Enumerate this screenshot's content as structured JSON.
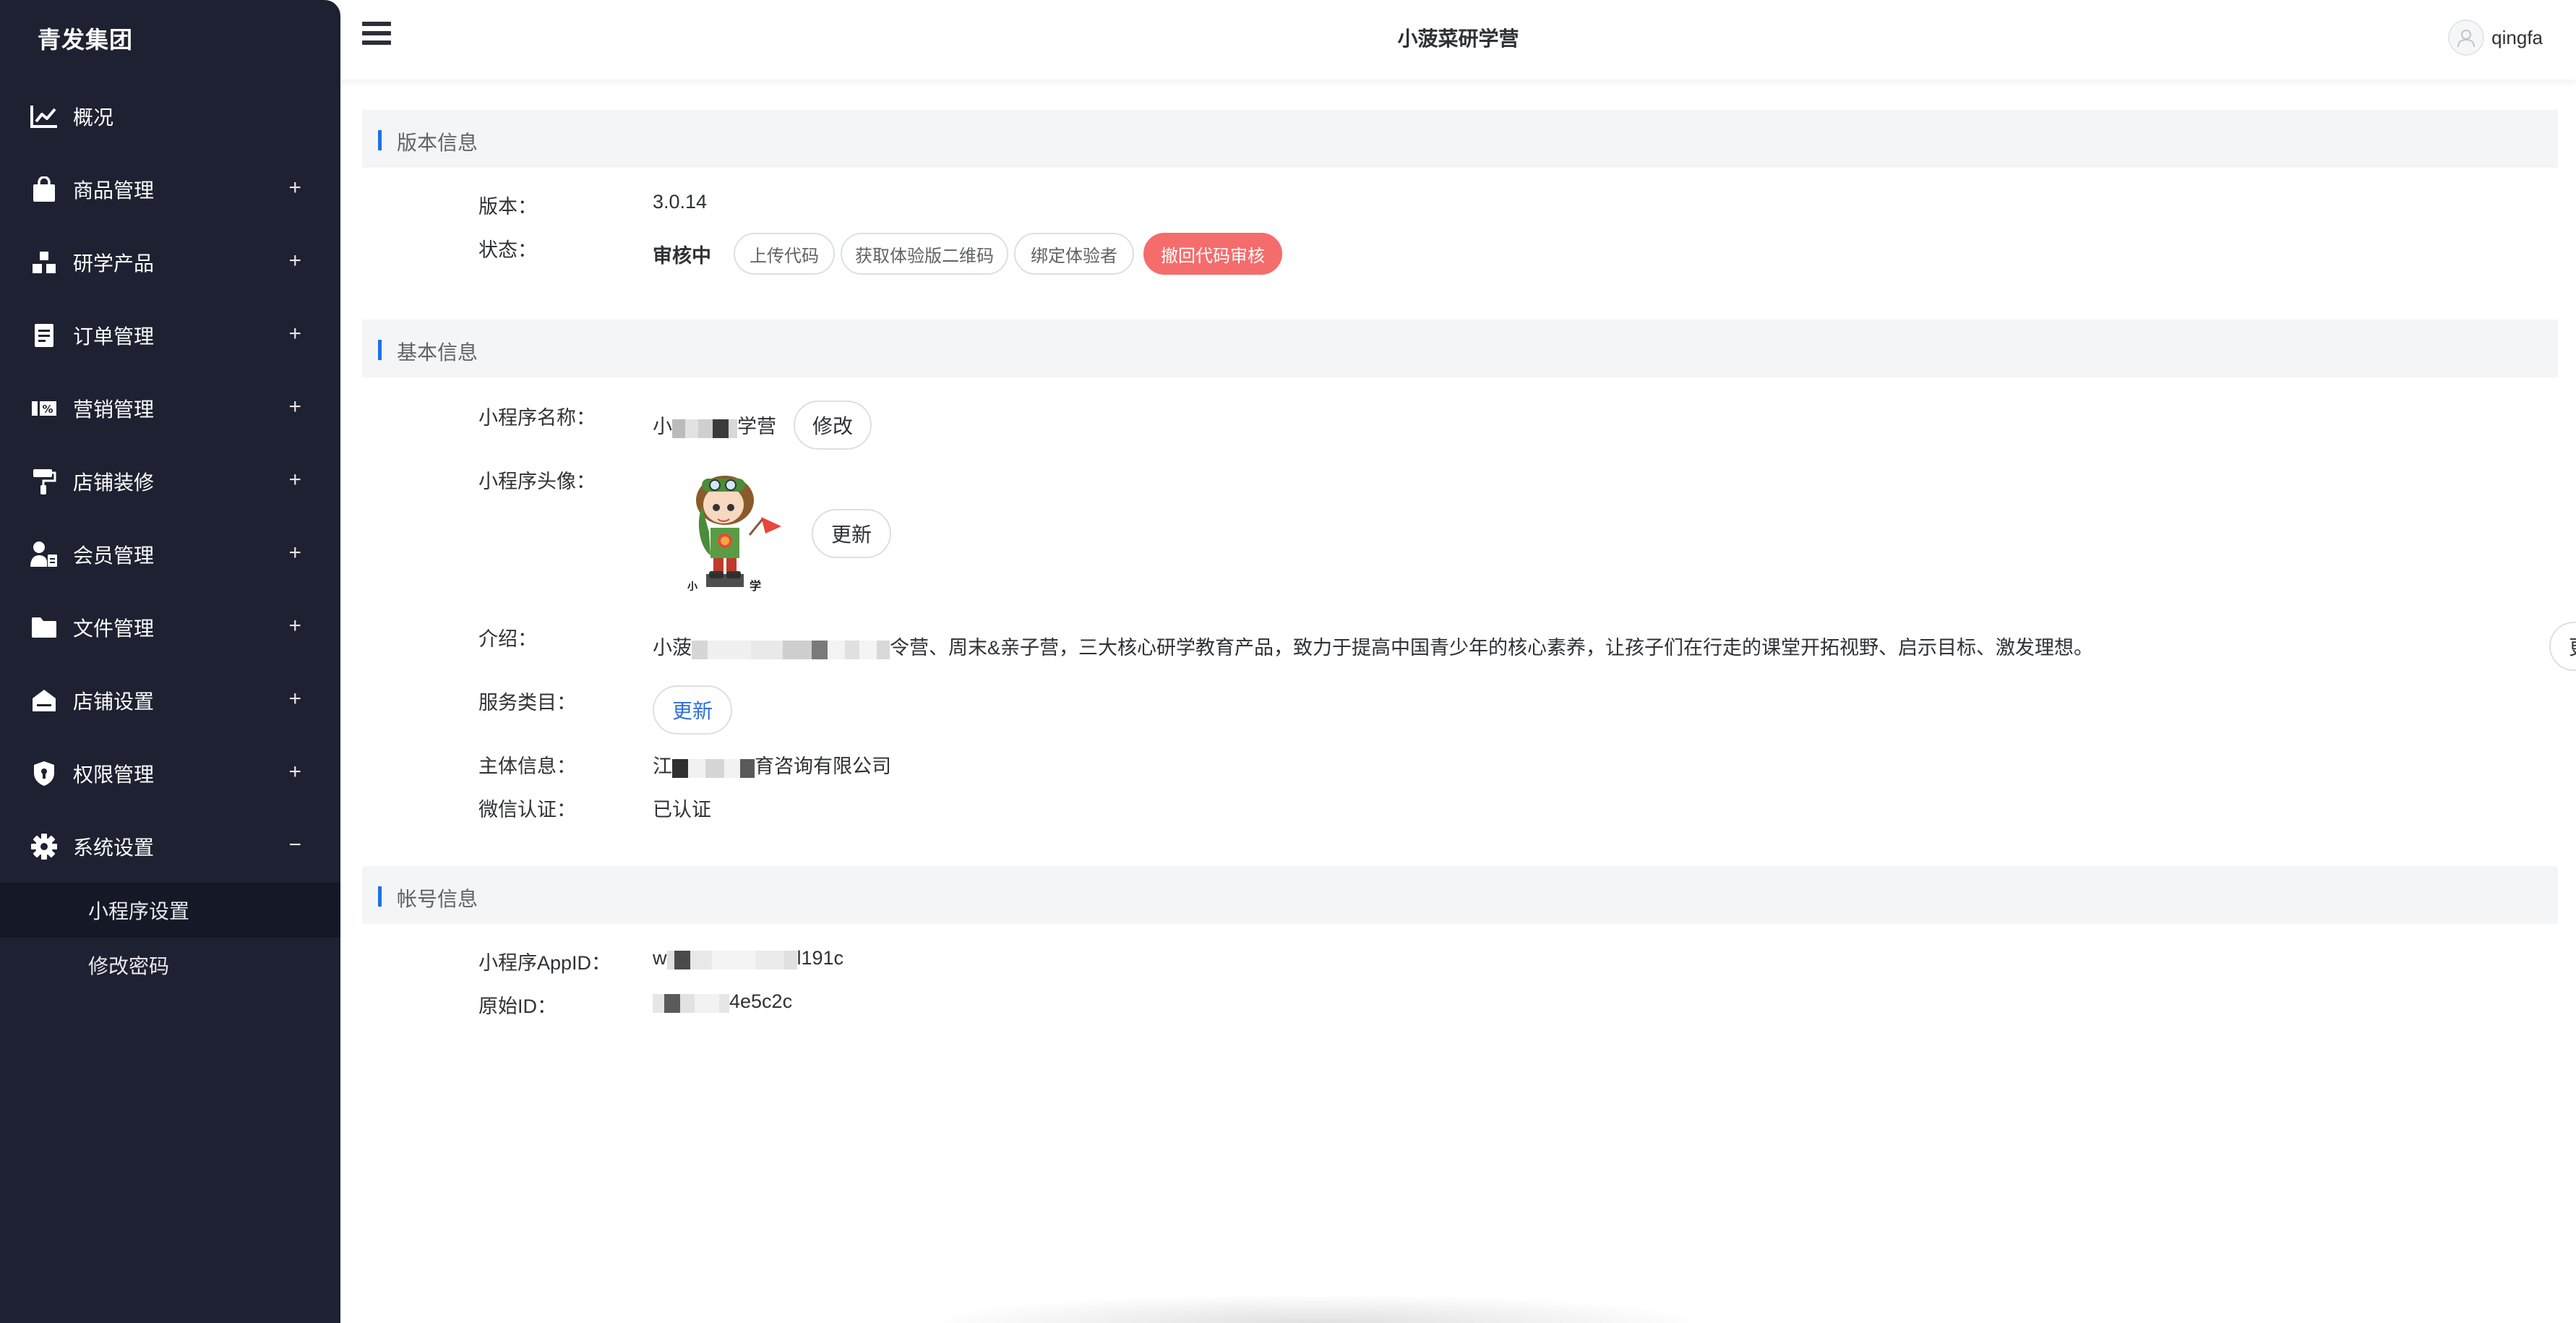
{
  "sidebar": {
    "brand": "青发集团",
    "items": [
      {
        "label": "概况",
        "icon": "chart-line-icon",
        "toggle": ""
      },
      {
        "label": "商品管理",
        "icon": "shopping-bag-icon",
        "toggle": "+"
      },
      {
        "label": "研学产品",
        "icon": "cubes-icon",
        "toggle": "+"
      },
      {
        "label": "订单管理",
        "icon": "document-icon",
        "toggle": "+"
      },
      {
        "label": "营销管理",
        "icon": "percent-tag-icon",
        "toggle": "+"
      },
      {
        "label": "店铺装修",
        "icon": "paint-roller-icon",
        "toggle": "+"
      },
      {
        "label": "会员管理",
        "icon": "user-card-icon",
        "toggle": "+"
      },
      {
        "label": "文件管理",
        "icon": "folder-icon",
        "toggle": "+"
      },
      {
        "label": "店铺设置",
        "icon": "store-icon",
        "toggle": "+"
      },
      {
        "label": "权限管理",
        "icon": "shield-icon",
        "toggle": "+"
      },
      {
        "label": "系统设置",
        "icon": "gear-icon",
        "toggle": "−"
      }
    ],
    "subitems": [
      {
        "label": "小程序设置",
        "active": true
      },
      {
        "label": "修改密码",
        "active": false
      }
    ]
  },
  "header": {
    "title": "小菠菜研学营",
    "username": "qingfa"
  },
  "sections": {
    "version": {
      "title": "版本信息",
      "version_label": "版本：",
      "version_value": "3.0.14",
      "status_label": "状态：",
      "status_value": "审核中",
      "buttons": [
        "上传代码",
        "获取体验版二维码",
        "绑定体验者",
        "撤回代码审核"
      ]
    },
    "basic": {
      "title": "基本信息",
      "name_label": "小程序名称：",
      "name_prefix": "小",
      "name_suffix": "学营",
      "name_button": "修改",
      "avatar_label": "小程序头像：",
      "avatar_button": "更新",
      "intro_label": "介绍：",
      "intro_prefix": "小菠",
      "intro_suffix": "令营、周末&亲子营，三大核心研学教育产品，致力于提高中国青少年的核心素养，让孩子们在行走的课堂开拓视野、启示目标、激发理想。",
      "intro_button": "更新",
      "category_label": "服务类目：",
      "category_button": "更新",
      "entity_label": "主体信息：",
      "entity_prefix": "江",
      "entity_suffix": "育咨询有限公司",
      "wechat_label": "微信认证：",
      "wechat_value": "已认证"
    },
    "account": {
      "title": "帐号信息",
      "appid_label": "小程序AppID：",
      "appid_prefix": "w",
      "appid_suffix": "l191c",
      "origin_label": "原始ID：",
      "origin_suffix": "4e5c2c"
    }
  },
  "colors": {
    "sidebar_bg": "#1d2131",
    "accent": "#1e6fe8",
    "danger": "#f56c6c"
  }
}
